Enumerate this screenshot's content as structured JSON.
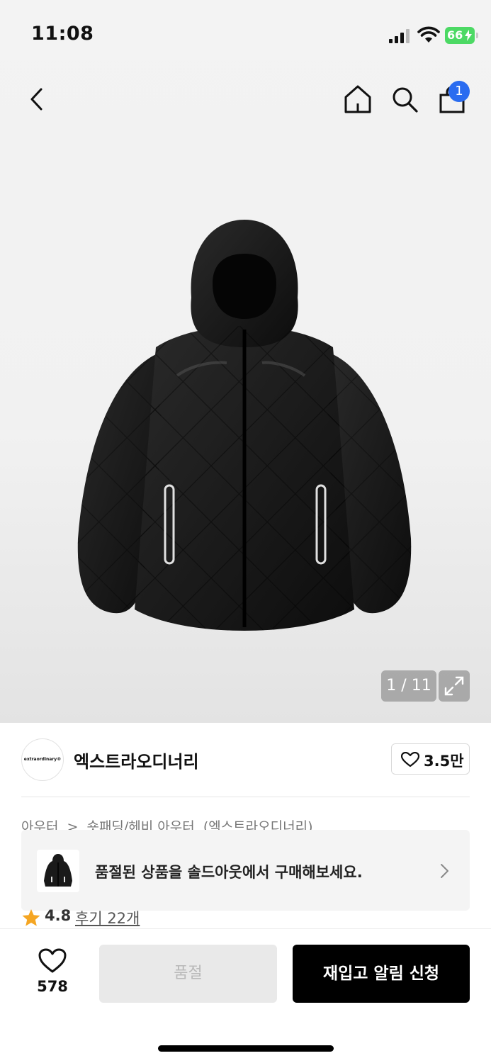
{
  "status_bar": {
    "time": "11:08",
    "battery": "66",
    "icons": [
      "signal-icon",
      "wifi-icon",
      "battery-icon"
    ]
  },
  "nav": {
    "icons": [
      "back-icon",
      "home-icon",
      "search-icon",
      "cart-icon"
    ],
    "cart_badge": "1"
  },
  "product_image": {
    "counter": "1 / 11",
    "expand_icon": "expand-icon"
  },
  "brand": {
    "logo_text": "extraordinary®",
    "name": "엑스트라오디너리",
    "like_count": "3.5만"
  },
  "breadcrumb": [
    "아우터",
    ">",
    "숏패딩/헤비 아우터",
    "(엑스트라오디너리)"
  ],
  "soldout_banner": {
    "text": "품절된 상품을 솔드아웃에서 구매해보세요."
  },
  "rating": {
    "score": "4.8",
    "reviews": "후기 22개"
  },
  "action_bar": {
    "wish_count": "578",
    "soldout_label": "품절",
    "restock_label": "재입고 알림 신청"
  },
  "colors": {
    "accent_blue": "#2a6cf0",
    "star": "#f5a623",
    "primary_button": "#000000",
    "disabled_button": "#e9e9e9"
  }
}
